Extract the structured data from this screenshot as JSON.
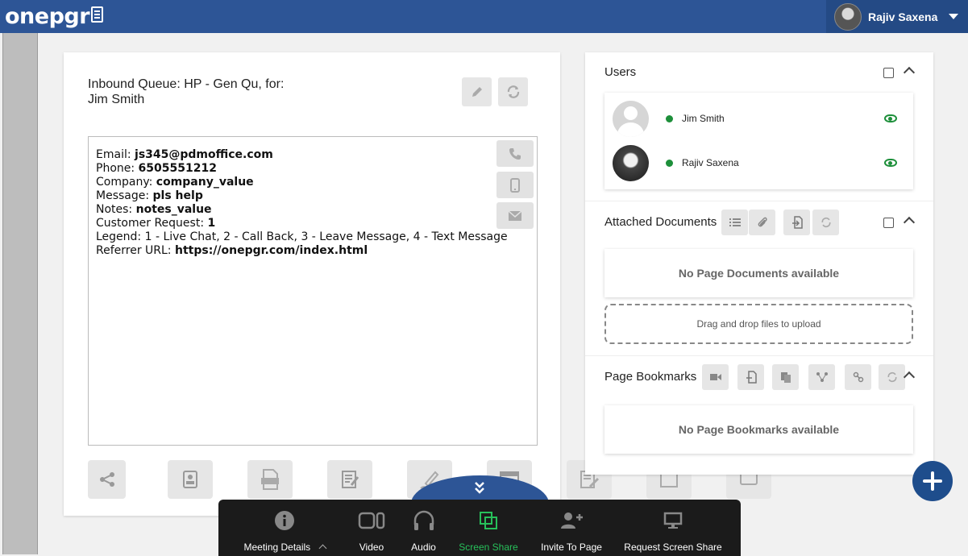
{
  "header": {
    "logo_text": "onepgr",
    "user_name": "Rajiv Saxena",
    "brand_color": "#2d5596"
  },
  "queue": {
    "title_line1": "Inbound Queue: HP - Gen Qu, for:",
    "title_line2": "Jim Smith"
  },
  "details": {
    "email_label": "Email:",
    "email_value": "js345@pdmoffice.com",
    "phone_label": "Phone:",
    "phone_value": "6505551212",
    "company_label": "Company:",
    "company_value": "company_value",
    "message_label": "Message:",
    "message_value": "pls help",
    "notes_label": "Notes:",
    "notes_value": "notes_value",
    "request_label": "Customer Request:",
    "request_value": "1",
    "legend": "Legend: 1 - Live Chat, 2 - Call Back, 3 - Leave Message, 4 - Text Message",
    "referrer_label": "Referrer URL:",
    "referrer_value": "https://onepgr.com/index.html"
  },
  "users": {
    "title": "Users",
    "list": [
      {
        "name": "Jim Smith",
        "status_color": "#1d8f3a"
      },
      {
        "name": "Rajiv Saxena",
        "status_color": "#1d8f3a"
      }
    ]
  },
  "documents": {
    "title": "Attached Documents",
    "empty_text": "No Page Documents available",
    "dropzone_text": "Drag and drop files to upload"
  },
  "bookmarks": {
    "title": "Page Bookmarks",
    "empty_text": "No Page Bookmarks available"
  },
  "meeting_bar": {
    "items": [
      {
        "label": "Meeting Details",
        "icon": "info-icon"
      },
      {
        "label": "Video",
        "icon": "video-icon"
      },
      {
        "label": "Audio",
        "icon": "headphones-icon"
      },
      {
        "label": "Screen Share",
        "icon": "screen-share-icon",
        "active": true
      },
      {
        "label": "Invite To Page",
        "icon": "add-user-icon"
      },
      {
        "label": "Request Screen Share",
        "icon": "monitor-icon"
      }
    ],
    "active_color": "#27c05a"
  }
}
